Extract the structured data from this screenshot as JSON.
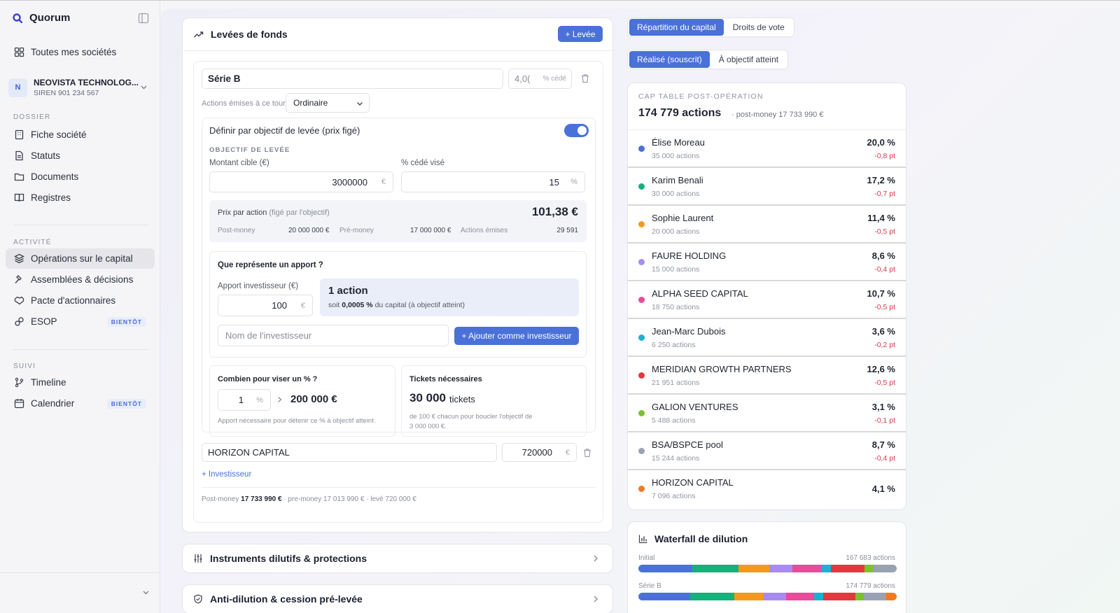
{
  "app": {
    "name": "Quorum"
  },
  "sidebar": {
    "all_companies": "Toutes mes sociétés",
    "company": {
      "initial": "N",
      "name": "NEOVISTA TECHNOLOG...",
      "siren": "SIREN 901 234 567"
    },
    "sections": {
      "dossier": "DOSSIER",
      "activite": "ACTIVITÉ",
      "suivi": "SUIVI"
    },
    "items": {
      "fiche": "Fiche société",
      "statuts": "Statuts",
      "documents": "Documents",
      "registres": "Registres",
      "operations": "Opérations sur le capital",
      "assemblees": "Assemblées & décisions",
      "pacte": "Pacte d'actionnaires",
      "esop": "ESOP",
      "timeline": "Timeline",
      "calendrier": "Calendrier"
    },
    "soon_badge": "BIENTÔT"
  },
  "levees": {
    "title": "Levées de fonds",
    "add_button": "+ Levée",
    "round_name": "Série B",
    "round_pct_value": "4,0(",
    "round_pct_unit": "% cédé",
    "shares_label": "Actions émises à ce tour",
    "shares_type": "Ordinaire",
    "objective_toggle_label": "Définir par objectif de levée (prix figé)",
    "objective_section": "OBJECTIF DE LEVÉE",
    "target_amount_label": "Montant cible (€)",
    "target_amount_value": "3000000",
    "target_amount_unit": "€",
    "target_pct_label": "% cédé visé",
    "target_pct_value": "15",
    "target_pct_unit": "%",
    "price_label": "Prix par action",
    "price_hint": "(figé par l'objectif)",
    "price_value": "101,38 €",
    "post_money_label": "Post-money",
    "post_money_value": "20 000 000 €",
    "pre_money_label": "Pré-money",
    "pre_money_value": "17 000 000 €",
    "shares_issued_label": "Actions émises",
    "shares_issued_value": "29 591",
    "apport_title": "Que représente un apport ?",
    "apport_label": "Apport investisseur (€)",
    "apport_value": "100",
    "apport_unit": "€",
    "apport_result_title": "1 action",
    "apport_result_prefix": "soit",
    "apport_result_pct": "0,0005 %",
    "apport_result_suffix": "du capital (à objectif atteint)",
    "investor_name_placeholder": "Nom de l'investisseur",
    "add_investor_button": "+ Ajouter comme investisseur",
    "combien_title": "Combien pour viser un % ?",
    "combien_pct_value": "1",
    "combien_pct_unit": "%",
    "combien_result": "200 000 €",
    "combien_hint": "Apport nécessaire pour détenir ce % à objectif atteint.",
    "tickets_title": "Tickets nécessaires",
    "tickets_count": "30 000",
    "tickets_word": "tickets",
    "tickets_hint_line1": "de 100 € chacun pour boucler l'objectif de",
    "tickets_hint_line2": "3 000 000 €.",
    "investor_row_name": "HORIZON CAPITAL",
    "investor_row_amount": "720000",
    "investor_row_unit": "€",
    "add_investor_link": "+ Investisseur",
    "footer_post_label": "Post-money",
    "footer_post_value": "17 733 990 €",
    "footer_rest": "· pre-money 17 013 990 € · levé 720 000 €"
  },
  "instruments": {
    "title": "Instruments dilutifs & protections"
  },
  "antidilution": {
    "title": "Anti-dilution & cession pré-levée"
  },
  "tabs_top": {
    "a": "Répartition du capital",
    "b": "Droits de vote"
  },
  "tabs_mode": {
    "a": "Réalisé (souscrit)",
    "b": "À objectif atteint"
  },
  "captable": {
    "section": "CAP TABLE POST-OPÉRATION",
    "total": "174 779 actions",
    "total_sub": "· post-money 17 733 990 €",
    "holders": [
      {
        "name": "Élise Moreau",
        "shares": "35 000 actions",
        "pct": "20,0 %",
        "delta": "-0,8 pt",
        "color": "#4a71d8"
      },
      {
        "name": "Karim Benali",
        "shares": "30 000 actions",
        "pct": "17,2 %",
        "delta": "-0,7 pt",
        "color": "#16b07a"
      },
      {
        "name": "Sophie Laurent",
        "shares": "20 000 actions",
        "pct": "11,4 %",
        "delta": "-0,5 pt",
        "color": "#f29a1f"
      },
      {
        "name": "FAURE HOLDING",
        "shares": "15 000 actions",
        "pct": "8,6 %",
        "delta": "-0,4 pt",
        "color": "#a78bf0"
      },
      {
        "name": "ALPHA SEED CAPITAL",
        "shares": "18 750 actions",
        "pct": "10,7 %",
        "delta": "-0,5 pt",
        "color": "#e64c9a"
      },
      {
        "name": "Jean-Marc Dubois",
        "shares": "6 250 actions",
        "pct": "3,6 %",
        "delta": "-0,2 pt",
        "color": "#1ab0d6"
      },
      {
        "name": "MERIDIAN GROWTH PARTNERS",
        "shares": "21 951 actions",
        "pct": "12,6 %",
        "delta": "-0,5 pt",
        "color": "#e03a3e"
      },
      {
        "name": "GALION VENTURES",
        "shares": "5 488 actions",
        "pct": "3,1 %",
        "delta": "-0,1 pt",
        "color": "#7ac22e"
      },
      {
        "name": "BSA/BSPCE pool",
        "shares": "15 244 actions",
        "pct": "8,7 %",
        "delta": "-0,4 pt",
        "color": "#98a2b3"
      },
      {
        "name": "HORIZON CAPITAL",
        "shares": "7 096 actions",
        "pct": "4,1 %",
        "delta": "",
        "color": "#f07a22"
      }
    ]
  },
  "waterfall": {
    "title": "Waterfall de dilution",
    "rows": [
      {
        "label": "Initial",
        "total": "167 683 actions",
        "segments": [
          20.9,
          17.9,
          11.9,
          8.9,
          11.2,
          3.7,
          13.1,
          3.3,
          9.1
        ]
      },
      {
        "label": "Série B",
        "total": "174 779 actions",
        "segments": [
          20.0,
          17.2,
          11.4,
          8.6,
          10.7,
          3.6,
          12.6,
          3.1,
          8.7,
          4.1
        ]
      }
    ]
  }
}
